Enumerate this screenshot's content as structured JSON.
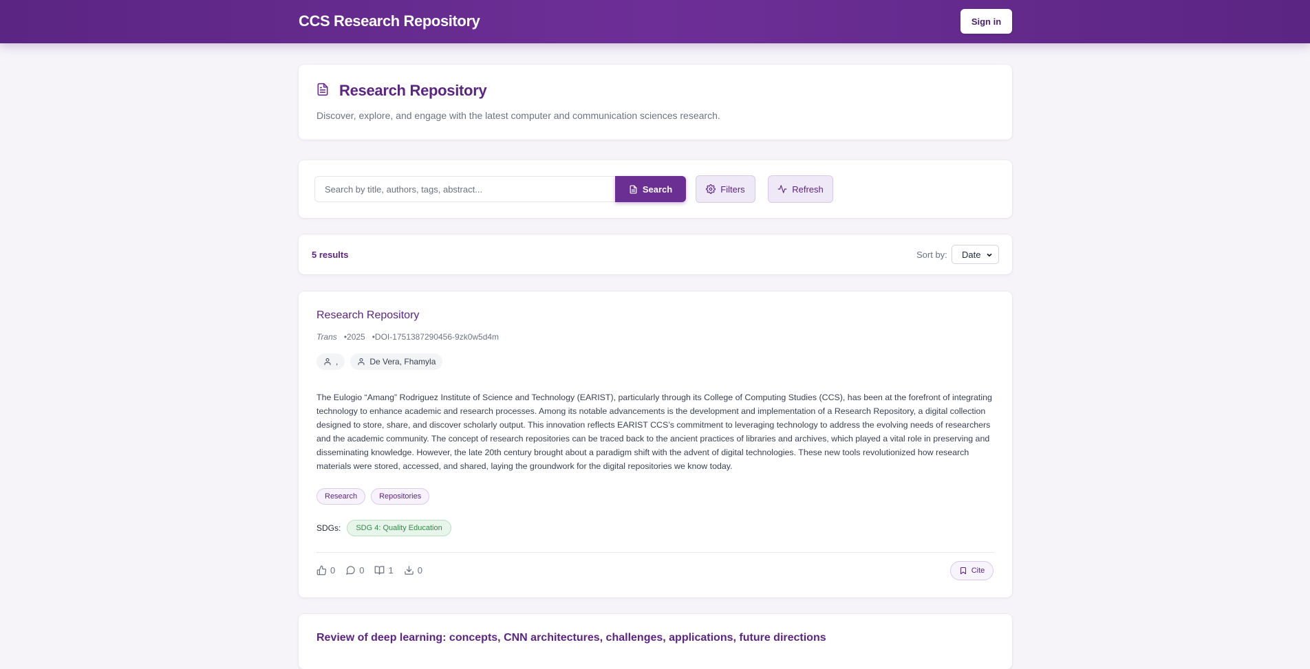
{
  "header": {
    "brand": "CCS Research Repository",
    "signin_label": "Sign in"
  },
  "hero": {
    "title": "Research Repository",
    "subtitle": "Discover, explore, and engage with the latest computer and communication sciences research.",
    "icon": "document-icon"
  },
  "search": {
    "placeholder": "Search by title, authors, tags, abstract...",
    "value": "",
    "search_label": "Search",
    "filters_label": "Filters",
    "refresh_label": "Refresh"
  },
  "results": {
    "count_text": "5 results",
    "sort_label": "Sort by:",
    "sort_value": "Date"
  },
  "papers": [
    {
      "title": "Research Repository",
      "journal": "Trans",
      "year": "•2025",
      "doi": "•DOI-1751387290456-9zk0w5d4m",
      "authors": [
        ",",
        "De Vera, Fhamyla"
      ],
      "abstract": "The Eulogio “Amang” Rodriguez Institute of Science and Technology (EARIST), particularly through its College of Computing Studies (CCS), has been at the forefront of integrating technology to enhance academic and research processes. Among its notable advancements is the development and implementation of a Research Repository, a digital collection designed to store, share, and discover scholarly output. This innovation reflects EARIST CCS’s commitment to leveraging technology to address the evolving needs of researchers and the academic community. The concept of research repositories can be traced back to the ancient practices of libraries and archives, which played a vital role in preserving and disseminating knowledge. However, the late 20th century brought about a paradigm shift with the advent of digital technologies. These new tools revolutionized how research materials were stored, accessed, and shared, laying the groundwork for the digital repositories we know today.",
      "tags": [
        "Research",
        "Repositories"
      ],
      "sdg_label": "SDGs:",
      "sdgs": [
        "SDG 4: Quality Education"
      ],
      "stats": {
        "likes": "0",
        "comments": "0",
        "reads": "1",
        "downloads": "0"
      },
      "cite_label": "Cite"
    },
    {
      "title": "Review of deep learning: concepts, CNN architectures, challenges, applications, future directions"
    }
  ],
  "colors": {
    "brand": "#5b2583",
    "primary_button": "#6b2e93",
    "sdg_green": "#2f8a47"
  }
}
